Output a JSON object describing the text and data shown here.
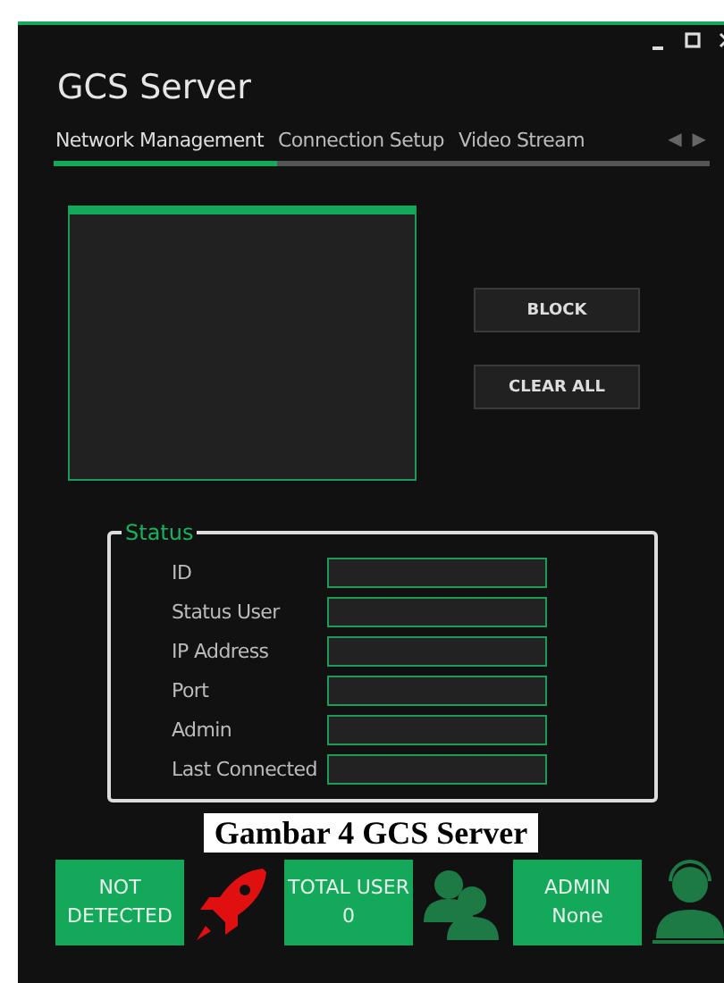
{
  "window": {
    "title": "GCS Server"
  },
  "tabs": [
    {
      "label": "Network Management",
      "selected": true
    },
    {
      "label": "Connection Setup",
      "selected": false
    },
    {
      "label": "Video Stream",
      "selected": false
    }
  ],
  "tab_scroll": [
    "◀",
    "▶"
  ],
  "buttons": [
    "BLOCK",
    "CLEAR ALL"
  ],
  "status": {
    "title": "Status",
    "fields": [
      {
        "label": "ID"
      },
      {
        "label": "Status User"
      },
      {
        "label": "IP Address"
      },
      {
        "label": "Port"
      },
      {
        "label": "Admin"
      },
      {
        "label": "Last Connected"
      }
    ]
  },
  "tiles": [
    {
      "lines": [
        "NOT",
        "DETECTED"
      ]
    },
    {
      "lines": [
        "TOTAL USER",
        "0"
      ]
    },
    {
      "lines": [
        "ADMIN",
        "None"
      ]
    }
  ],
  "caption": "Gambar 4 GCS Server"
}
